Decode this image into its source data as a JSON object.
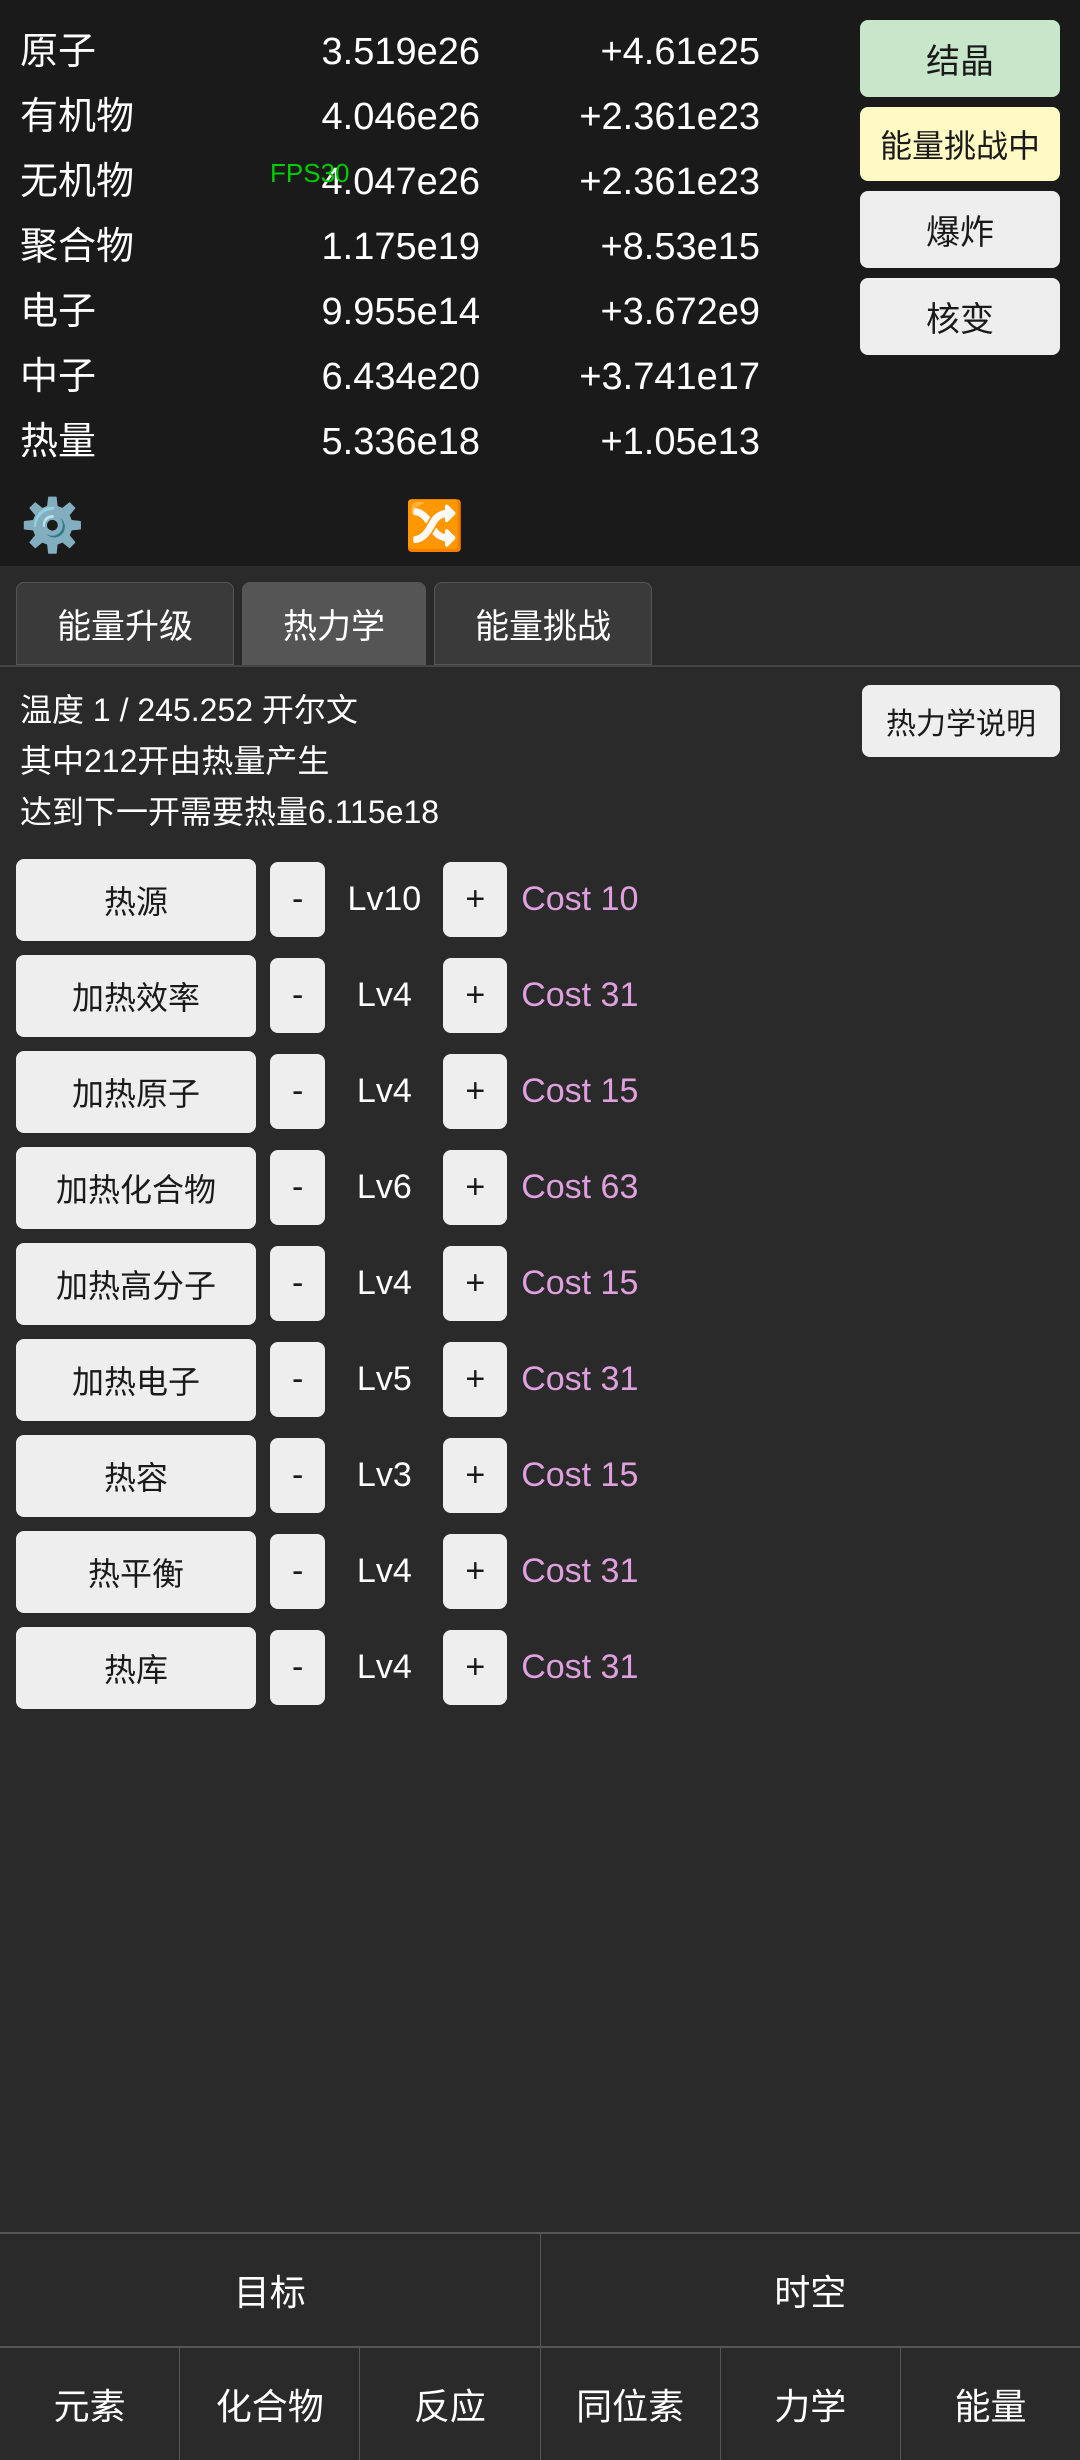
{
  "stats": [
    {
      "label": "原子",
      "value": "3.519e26",
      "delta": "+4.61e25"
    },
    {
      "label": "有机物",
      "value": "4.046e26",
      "delta": "+2.361e23"
    },
    {
      "label": "无机物",
      "value": "4.047e26",
      "delta": "+2.361e23"
    },
    {
      "label": "聚合物",
      "value": "1.175e19",
      "delta": "+8.53e15"
    },
    {
      "label": "电子",
      "value": "9.955e14",
      "delta": "+3.672e9"
    },
    {
      "label": "中子",
      "value": "6.434e20",
      "delta": "+3.741e17"
    },
    {
      "label": "热量",
      "value": "5.336e18",
      "delta": "+1.05e13"
    }
  ],
  "fps": "FPS30",
  "buttons": {
    "crystal": "结晶",
    "energy_challenge": "能量挑战中",
    "explode": "爆炸",
    "nuclear": "核变"
  },
  "tabs": [
    {
      "label": "能量升级",
      "active": false
    },
    {
      "label": "热力学",
      "active": true
    },
    {
      "label": "能量挑战",
      "active": false
    }
  ],
  "thermo": {
    "line1": "温度 1 / 245.252 开尔文",
    "line2": "其中212开由热量产生",
    "line3": "达到下一开需要热量6.115e18",
    "explain_btn": "热力学说明"
  },
  "upgrades": [
    {
      "name": "热源",
      "level": "Lv10",
      "cost": "Cost 10"
    },
    {
      "name": "加热效率",
      "level": "Lv4",
      "cost": "Cost 31"
    },
    {
      "name": "加热原子",
      "level": "Lv4",
      "cost": "Cost 15"
    },
    {
      "name": "加热化合物",
      "level": "Lv6",
      "cost": "Cost 63"
    },
    {
      "name": "加热高分子",
      "level": "Lv4",
      "cost": "Cost 15"
    },
    {
      "name": "加热电子",
      "level": "Lv5",
      "cost": "Cost 31"
    },
    {
      "name": "热容",
      "level": "Lv3",
      "cost": "Cost 15"
    },
    {
      "name": "热平衡",
      "level": "Lv4",
      "cost": "Cost 31"
    },
    {
      "name": "热库",
      "level": "Lv4",
      "cost": "Cost 31"
    }
  ],
  "bottom_nav_row1": [
    {
      "label": "目标",
      "active": false
    },
    {
      "label": "时空",
      "active": false
    }
  ],
  "bottom_nav_row2": [
    {
      "label": "元素",
      "active": false
    },
    {
      "label": "化合物",
      "active": false
    },
    {
      "label": "反应",
      "active": false
    },
    {
      "label": "同位素",
      "active": false
    },
    {
      "label": "力学",
      "active": false
    },
    {
      "label": "能量",
      "active": false
    }
  ]
}
